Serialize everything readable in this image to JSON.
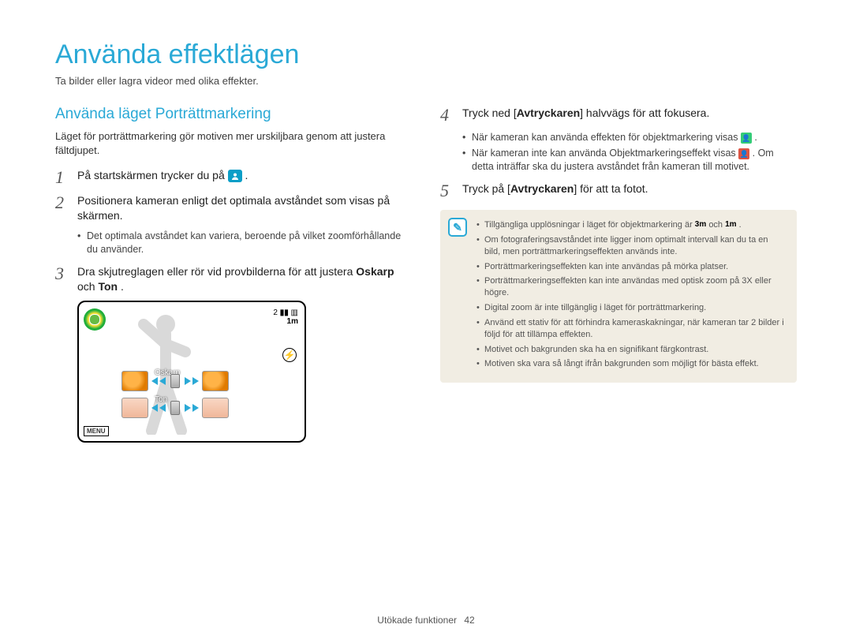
{
  "title": "Använda effektlägen",
  "subtitle": "Ta bilder eller lagra videor med olika effekter.",
  "section_title": "Använda läget Porträttmarkering",
  "intro": "Läget för porträttmarkering gör motiven mer urskiljbara genom att justera fältdjupet.",
  "steps": {
    "s1_pre": "På startskärmen trycker du på ",
    "s1_post": ".",
    "s2": "Positionera kameran enligt det optimala avståndet som visas på skärmen.",
    "s2_sub": "Det optimala avståndet kan variera, beroende på vilket zoomförhållande du använder.",
    "s3_pre": "Dra skjutreglagen eller rör vid provbilderna för att justera ",
    "s3_b1": "Oskarp",
    "s3_mid": " och ",
    "s3_b2": "Ton",
    "s3_post": ".",
    "s4_pre": "Tryck ned [",
    "s4_b": "Avtryckaren",
    "s4_post": "] halvvägs för att fokusera.",
    "s4_sub1_pre": "När kameran kan använda effekten för objektmarkering visas ",
    "s4_sub1_post": ".",
    "s4_sub2_pre": "När kameran inte kan använda Objektmarkeringseffekt visas ",
    "s4_sub2_post": ". Om detta inträffar ska du justera avståndet från kameran till motivet.",
    "s5_pre": "Tryck på [",
    "s5_b": "Avtryckaren",
    "s5_post": "] för att ta fotot."
  },
  "screen": {
    "topright_count": "2",
    "topright_1m": "1m",
    "slider1_label": "Oskarp",
    "slider2_label": "Ton",
    "menu": "MENU"
  },
  "notes": {
    "n1_pre": "Tillgängliga upplösningar i läget för objektmarkering är ",
    "n1_mid": " och ",
    "n1_post": ".",
    "res1": "3m",
    "res2": "1m",
    "n2": "Om fotograferingsavståndet inte ligger inom optimalt intervall kan du ta en bild, men porträttmarkeringseffekten används inte.",
    "n3": "Porträttmarkeringseffekten kan inte användas på mörka platser.",
    "n4": "Porträttmarkeringseffekten kan inte användas med optisk zoom på 3X eller högre.",
    "n5": "Digital zoom är inte tillgänglig i läget för porträttmarkering.",
    "n6": "Använd ett stativ för att förhindra kameraskakningar, när kameran tar 2 bilder i följd för att tillämpa effekten.",
    "n7": "Motivet och bakgrunden ska ha en signifikant färgkontrast.",
    "n8": "Motiven ska vara så långt ifrån bakgrunden som möjligt för bästa effekt."
  },
  "footer": {
    "section": "Utökade funktioner",
    "page": "42"
  }
}
